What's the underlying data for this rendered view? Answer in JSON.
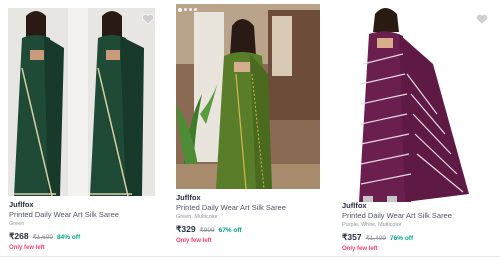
{
  "products": [
    {
      "brand": "Juflfox",
      "title": "Printed Daily Wear Art Silk Saree",
      "colors": "Green",
      "price": "₹268",
      "mrp": "₹1,699",
      "discount": "84% off",
      "stock_note": "Only few left",
      "image_icon": "saree-green-twin-models-image",
      "accent": "#1e4a36"
    },
    {
      "brand": "Juflfox",
      "title": "Printed Daily Wear Art Silk Saree",
      "colors": "Green, Multicolor",
      "price": "₹329",
      "mrp": "₹999",
      "discount": "67% off",
      "stock_note": "Only few left",
      "image_icon": "saree-olive-green-model-image",
      "accent": "#5a7d2a"
    },
    {
      "brand": "Juflfox",
      "title": "Printed Daily Wear Art Silk Saree",
      "colors": "Purple, White, Multicolor",
      "price": "₹357",
      "mrp": "₹1,499",
      "discount": "76% off",
      "stock_note": "Only few left",
      "image_icon": "saree-purple-model-image",
      "accent": "#6b1f4f"
    }
  ],
  "colors": {
    "price_text": "#282c3f",
    "discount": "#03a685",
    "stock_note": "#ff3f6c",
    "muted": "#94969f"
  }
}
